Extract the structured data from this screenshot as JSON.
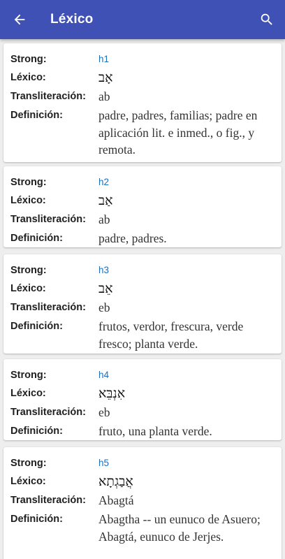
{
  "appbar": {
    "title": "Léxico",
    "back_icon": "arrow-back-icon",
    "search_icon": "search-icon",
    "color": "#3f51b5"
  },
  "labels": {
    "strong": "Strong:",
    "lexico": "Léxico:",
    "transliteracion": "Transliteración:",
    "definicion": "Definición:"
  },
  "entries": [
    {
      "strong": "h1",
      "lexico": "אָב",
      "transliteracion": "ab",
      "definicion": "padre, padres, familias; padre en aplicación lit. e inmed., o fig., y remota."
    },
    {
      "strong": "h2",
      "lexico": "אַב",
      "transliteracion": "ab",
      "definicion": "padre, padres."
    },
    {
      "strong": "h3",
      "lexico": "אֵב",
      "transliteracion": "eb",
      "definicion": "frutos, verdor, frescura, verde fresco; planta verde."
    },
    {
      "strong": "h4",
      "lexico": "אִנְבֵּא",
      "transliteracion": "eb",
      "definicion": "fruto, una planta verde."
    },
    {
      "strong": "h5",
      "lexico": "אֲבַגְתָא",
      "transliteracion": "Abagtá",
      "definicion": "Abagtha -- un eunuco de Asuero; Abagtá, eunuco de Jerjes."
    }
  ]
}
